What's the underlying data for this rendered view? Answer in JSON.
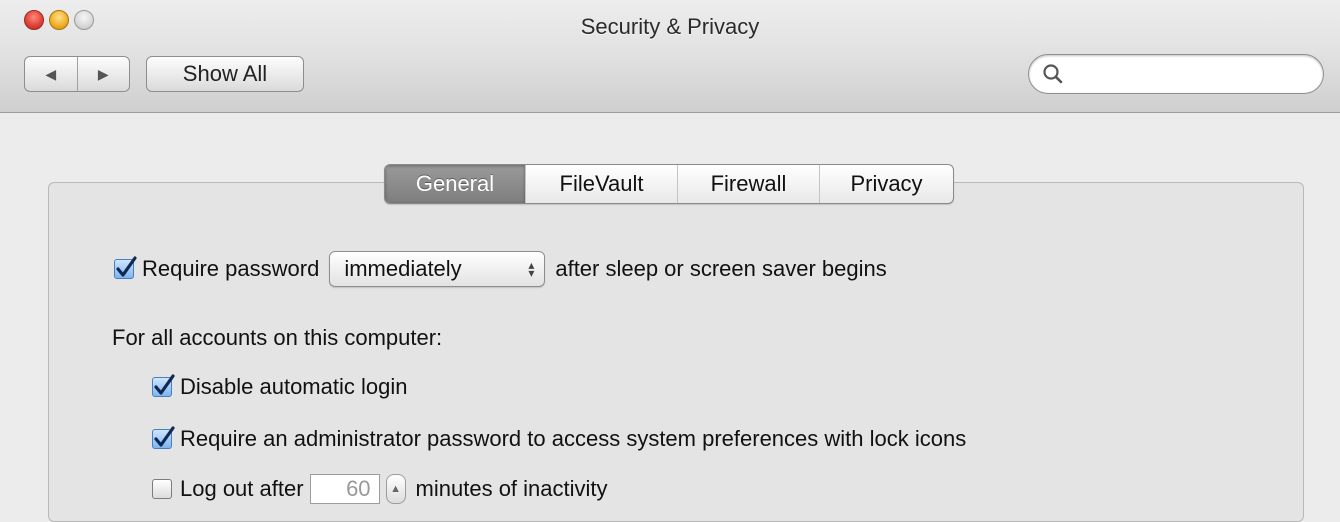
{
  "window": {
    "title": "Security & Privacy"
  },
  "toolbar": {
    "back_glyph": "◀",
    "forward_glyph": "▶",
    "show_all_label": "Show All",
    "search": {
      "value": "",
      "icon": "search-icon"
    }
  },
  "tabs": [
    {
      "label": "General",
      "selected": true
    },
    {
      "label": "FileVault",
      "selected": false
    },
    {
      "label": "Firewall",
      "selected": false
    },
    {
      "label": "Privacy",
      "selected": false
    }
  ],
  "general": {
    "require_password": {
      "checked": true,
      "label_before": "Require password",
      "popup_value": "immediately",
      "label_after": "after sleep or screen saver begins"
    },
    "accounts_heading": "For all accounts on this computer:",
    "options": [
      {
        "label": "Disable automatic login",
        "checked": true
      },
      {
        "label": "Require an administrator password to access system preferences with lock icons",
        "checked": true
      }
    ],
    "logout": {
      "checked": false,
      "label_before": "Log out after",
      "minutes_value": "60",
      "label_after": "minutes of inactivity"
    }
  },
  "colors": {
    "checkbox_accent": "#7eb4ef",
    "tab_selected": "#8a8a8a",
    "close_button": "#e0443a",
    "minimize_button": "#f2b12c"
  }
}
